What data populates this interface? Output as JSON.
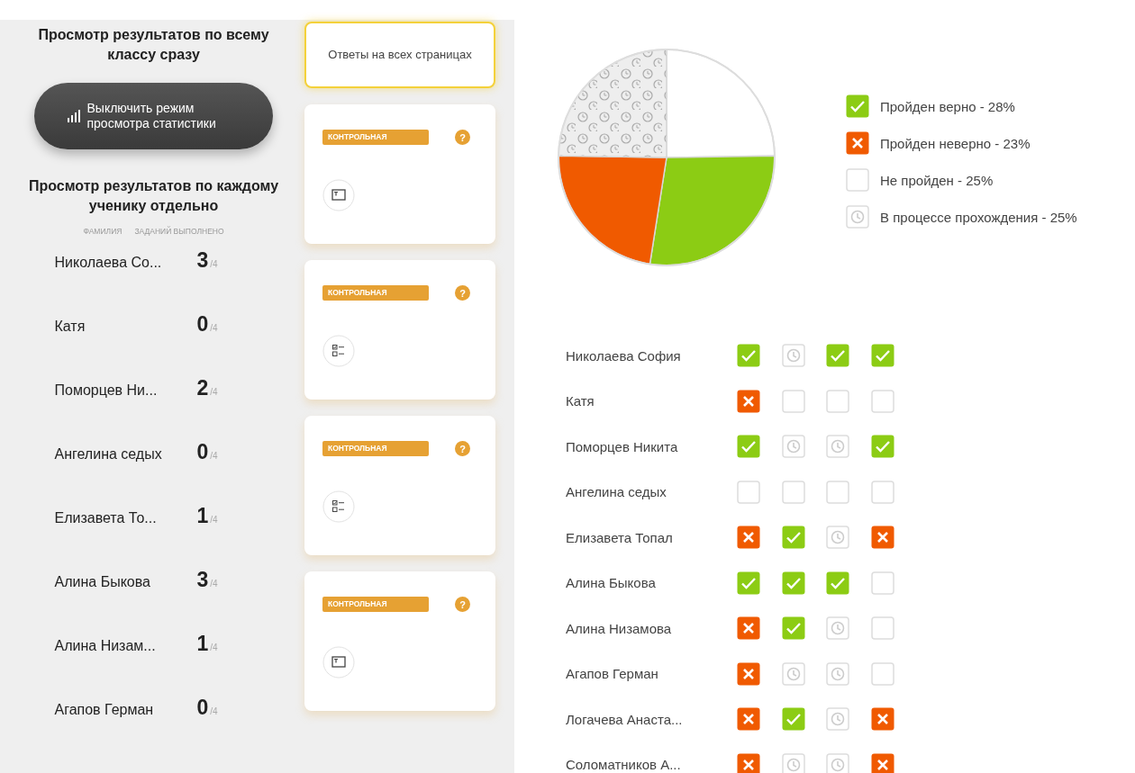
{
  "left_panel": {
    "class_heading": "Просмотр результатов по всему классу сразу",
    "stats_button": "Выключить режим просмотра статистики",
    "student_heading": "Просмотр результатов по каждому ученику отдельно",
    "columns": [
      "ФАМИЛИЯ",
      "ЗАДАНИЙ ВЫПОЛНЕНО"
    ],
    "students": [
      {
        "name": "Николаева Со...",
        "done": "3",
        "total": "/4"
      },
      {
        "name": "Катя",
        "done": "0",
        "total": "/4"
      },
      {
        "name": "Поморцев Ни...",
        "done": "2",
        "total": "/4"
      },
      {
        "name": "Ангелина седых",
        "done": "0",
        "total": "/4"
      },
      {
        "name": "Елизавета То...",
        "done": "1",
        "total": "/4"
      },
      {
        "name": "Алина Быкова",
        "done": "3",
        "total": "/4"
      },
      {
        "name": "Алина Низам...",
        "done": "1",
        "total": "/4"
      },
      {
        "name": "Агапов Герман",
        "done": "0",
        "total": "/4"
      }
    ]
  },
  "pages": {
    "all_pages_button": {
      "label": "Ответы на всех страницах",
      "selected": true
    },
    "cards": [
      {
        "badge": "КОНТРОЛЬНАЯ",
        "help": "?",
        "kind": "text"
      },
      {
        "badge": "КОНТРОЛЬНАЯ",
        "help": "?",
        "kind": "checklist"
      },
      {
        "badge": "КОНТРОЛЬНАЯ",
        "help": "?",
        "kind": "checklist"
      },
      {
        "badge": "КОНТРОЛЬНАЯ",
        "help": "?",
        "kind": "text"
      }
    ]
  },
  "statistics": {
    "chart_data": {
      "type": "pie",
      "categories": [
        "Пройден верно - 28%",
        "Пройден неверно - 23%",
        "Не пройден - 25%",
        "В процессе прохождения - 25%"
      ],
      "values": [
        28,
        23,
        25,
        25
      ]
    },
    "legend": [
      {
        "kind": "correct"
      },
      {
        "kind": "wrong"
      },
      {
        "kind": "not_started"
      },
      {
        "kind": "in_progress"
      }
    ],
    "rows": [
      {
        "name": "Николаева София",
        "results": [
          {
            "kind": "correct"
          },
          {
            "kind": "in_progress"
          },
          {
            "kind": "correct"
          },
          {
            "kind": "correct"
          }
        ]
      },
      {
        "name": "Катя",
        "results": [
          {
            "kind": "wrong"
          },
          {
            "kind": "not_started"
          },
          {
            "kind": "not_started"
          },
          {
            "kind": "not_started"
          }
        ]
      },
      {
        "name": "Поморцев Никита",
        "results": [
          {
            "kind": "correct"
          },
          {
            "kind": "in_progress"
          },
          {
            "kind": "in_progress"
          },
          {
            "kind": "correct"
          }
        ]
      },
      {
        "name": "Ангелина седых",
        "results": [
          {
            "kind": "not_started"
          },
          {
            "kind": "not_started"
          },
          {
            "kind": "not_started"
          },
          {
            "kind": "not_started"
          }
        ]
      },
      {
        "name": "Елизавета Топал",
        "results": [
          {
            "kind": "wrong"
          },
          {
            "kind": "correct"
          },
          {
            "kind": "in_progress"
          },
          {
            "kind": "wrong"
          }
        ]
      },
      {
        "name": "Алина Быкова",
        "results": [
          {
            "kind": "correct"
          },
          {
            "kind": "correct"
          },
          {
            "kind": "correct"
          },
          {
            "kind": "not_started"
          }
        ]
      },
      {
        "name": "Алина Низамова",
        "results": [
          {
            "kind": "wrong"
          },
          {
            "kind": "correct"
          },
          {
            "kind": "in_progress"
          },
          {
            "kind": "not_started"
          }
        ]
      },
      {
        "name": "Агапов Герман",
        "results": [
          {
            "kind": "wrong"
          },
          {
            "kind": "in_progress"
          },
          {
            "kind": "in_progress"
          },
          {
            "kind": "not_started"
          }
        ]
      },
      {
        "name": "Логачева Анаста...",
        "results": [
          {
            "kind": "wrong"
          },
          {
            "kind": "correct"
          },
          {
            "kind": "in_progress"
          },
          {
            "kind": "wrong"
          }
        ]
      },
      {
        "name": "Соломатников А...",
        "results": [
          {
            "kind": "wrong"
          },
          {
            "kind": "in_progress"
          },
          {
            "kind": "in_progress"
          },
          {
            "kind": "wrong"
          }
        ]
      }
    ]
  }
}
